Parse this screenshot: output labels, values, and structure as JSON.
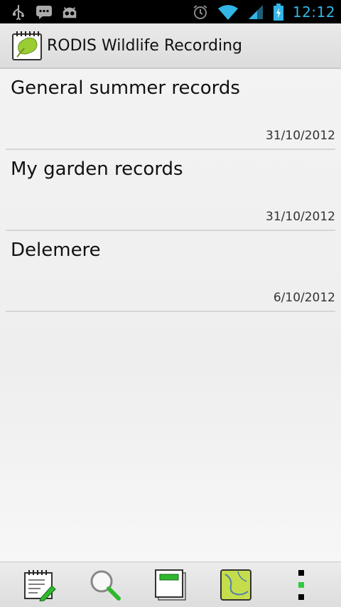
{
  "status_bar": {
    "time": "12:12",
    "left_icons": [
      "usb-icon",
      "message-icon",
      "android-icon"
    ],
    "right_icons": [
      "alarm-icon",
      "wifi-icon",
      "signal-icon",
      "battery-charging-icon"
    ],
    "accent": "#33b5e5"
  },
  "action_bar": {
    "title": "RODIS Wildlife Recording",
    "icon": "leaf-notebook-icon"
  },
  "list": {
    "items": [
      {
        "title": "General summer records",
        "date": "31/10/2012"
      },
      {
        "title": "My garden records",
        "date": "31/10/2012"
      },
      {
        "title": "Delemere",
        "date": "6/10/2012"
      }
    ]
  },
  "bottom_bar": {
    "buttons": [
      "new-record-icon",
      "search-icon",
      "records-icon",
      "map-icon",
      "overflow-menu-icon"
    ]
  }
}
